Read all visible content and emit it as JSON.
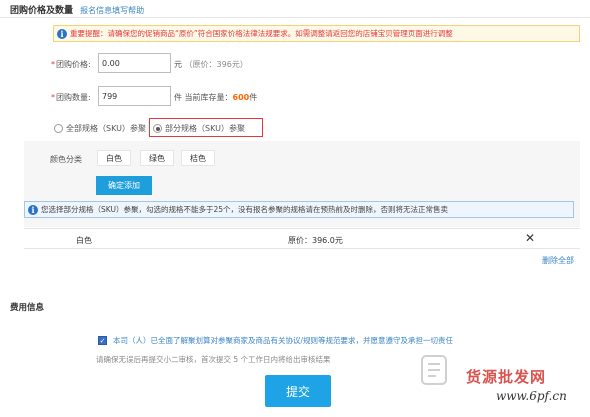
{
  "header": {
    "title": "团购价格及数量",
    "help_link": "报名信息填写帮助"
  },
  "notice": {
    "icon": "info-icon",
    "text": "重要提醒：请确保您的促销商品“原价”符合国家价格法律法规要求。如需调整请返回您的店铺宝贝管理页面进行调整"
  },
  "price": {
    "label": "团购价格:",
    "value": "0.00",
    "unit": "元",
    "original": "（原价：396元）"
  },
  "quantity": {
    "label": "团购数量:",
    "value": "799",
    "unit": "件",
    "stock_prefix": "当前库存量：",
    "stock_value": "600",
    "stock_unit": "件"
  },
  "sku_mode": {
    "all_label": "全部规格（SKU）参聚",
    "partial_label": "部分规格（SKU）参聚",
    "selected": "partial",
    "highlight_color": "#e4393c"
  },
  "color_category": {
    "label": "颜色分类",
    "options": [
      "白色",
      "绿色",
      "桔色"
    ],
    "confirm_button": "确定添加"
  },
  "tip": {
    "icon": "info-icon",
    "text": "您选择部分规格（SKU）参聚，勾选的规格不能多于25个，没有报名参聚的规格请在预热前及时删除，否则将无法正常售卖"
  },
  "sku_row": {
    "name": "白色",
    "price": "原价：396.0元",
    "remove_icon": "close-icon"
  },
  "delete_all": "删除全部",
  "fees": {
    "title": "费用信息",
    "agreement": "本司（人）已全面了解聚划算对参聚商家及商品有关协议/规则等规范要求，并愿意遵守及承担一切责任",
    "agreement_checked": true,
    "review_note": "请确保无误后再提交小二审核，首次提交 5 个工作日内将给出审核结果"
  },
  "submit_label": "提交",
  "watermark": {
    "brand": "货源批发网",
    "url": "www.6pf.cn"
  },
  "colors": {
    "accent": "#1e9edb",
    "link": "#3a84c4",
    "warning": "#e4393c",
    "stock": "#ff6600"
  }
}
